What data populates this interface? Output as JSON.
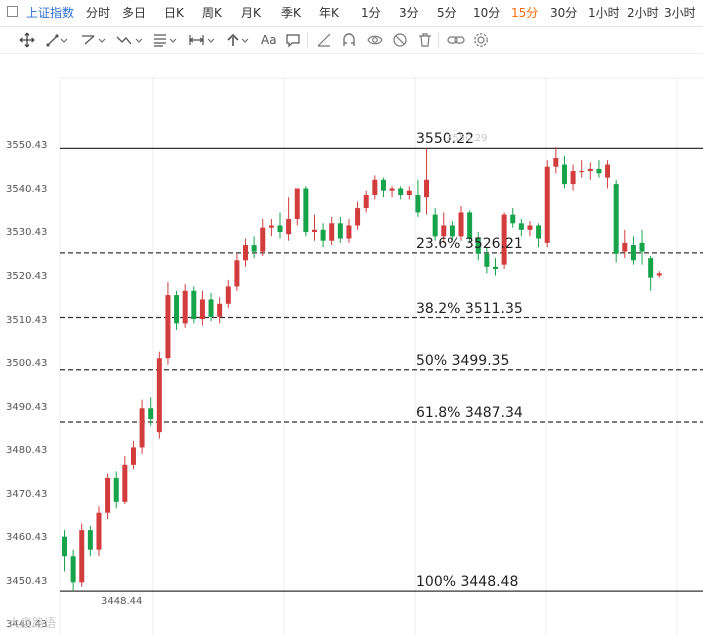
{
  "tabbar": {
    "tabs": [
      {
        "label": "上证指数",
        "type": "index"
      },
      {
        "label": "分时"
      },
      {
        "label": "多日"
      },
      {
        "label": "日K"
      },
      {
        "label": "周K"
      },
      {
        "label": "月K"
      },
      {
        "label": "季K"
      },
      {
        "label": "年K"
      },
      {
        "label": "1分"
      },
      {
        "label": "3分"
      },
      {
        "label": "5分"
      },
      {
        "label": "10分"
      },
      {
        "label": "15分",
        "active": true
      },
      {
        "label": "30分"
      },
      {
        "label": "1小时"
      },
      {
        "label": "2小时"
      },
      {
        "label": "3小时"
      }
    ]
  },
  "toolbar": {
    "icons": [
      "move-icon",
      "line-tool-icon",
      "parallel-channel-icon",
      "wave-tool-icon",
      "fibonacci-icon",
      "measure-icon",
      "arrow-up-icon",
      "text-tool-icon",
      "comment-icon",
      "ruler-icon",
      "magnet-icon",
      "visibility-icon",
      "hide-icon",
      "delete-icon",
      "link-icon",
      "settings-icon"
    ],
    "text_tool_label": "Aa"
  },
  "colors": {
    "up": "#d23c3c",
    "down": "#16a34a",
    "fib_line": "#333333",
    "grid": "#eeeeee",
    "active_tab": "#ff6a00"
  },
  "chart_data": {
    "type": "candlestick",
    "y_ticks": [
      "3550.43",
      "3540.43",
      "3530.43",
      "3520.43",
      "3510.43",
      "3500.43",
      "3490.43",
      "3480.43",
      "3470.43",
      "3460.43",
      "3450.43",
      "3440.43"
    ],
    "ylim": [
      3438.4,
      3571.9
    ],
    "low_marker": "3448.44",
    "high_ghost_label": "3550.29",
    "fib_levels": [
      {
        "label": "3550.22",
        "price": 3550.22,
        "style": "solid"
      },
      {
        "label": "23.6% 3526.21",
        "price": 3526.21,
        "style": "dashed"
      },
      {
        "label": "38.2% 3511.35",
        "price": 3511.35,
        "style": "dashed"
      },
      {
        "label": "50% 3499.35",
        "price": 3499.35,
        "style": "dashed"
      },
      {
        "label": "61.8% 3487.34",
        "price": 3487.34,
        "style": "dashed"
      },
      {
        "label": "100% 3448.48",
        "price": 3448.48,
        "style": "solid"
      }
    ],
    "candles": [
      [
        3461.0,
        3456.5,
        3462.5,
        3453.0
      ],
      [
        3456.5,
        3450.5,
        3458.0,
        3448.44
      ],
      [
        3450.5,
        3462.5,
        3464.0,
        3449.5
      ],
      [
        3462.5,
        3458.0,
        3463.5,
        3456.5
      ],
      [
        3458.0,
        3466.5,
        3468.0,
        3456.5
      ],
      [
        3466.5,
        3474.5,
        3475.5,
        3465.0
      ],
      [
        3474.5,
        3469.0,
        3476.0,
        3467.5
      ],
      [
        3469.0,
        3477.5,
        3479.5,
        3468.5
      ],
      [
        3477.5,
        3481.5,
        3483.0,
        3476.5
      ],
      [
        3481.5,
        3490.5,
        3492.5,
        3480.0
      ],
      [
        3490.5,
        3488.0,
        3493.0,
        3486.5
      ],
      [
        3485.0,
        3502.0,
        3503.5,
        3483.5
      ],
      [
        3502.0,
        3516.5,
        3519.5,
        3500.5
      ],
      [
        3516.5,
        3510.0,
        3517.5,
        3508.5
      ],
      [
        3510.0,
        3517.5,
        3519.0,
        3509.0
      ],
      [
        3517.5,
        3511.0,
        3518.5,
        3510.0
      ],
      [
        3511.0,
        3515.5,
        3517.5,
        3509.5
      ],
      [
        3515.5,
        3511.5,
        3517.0,
        3510.5
      ],
      [
        3511.5,
        3514.5,
        3516.0,
        3510.0
      ],
      [
        3514.5,
        3518.5,
        3520.0,
        3513.5
      ],
      [
        3518.5,
        3524.5,
        3526.0,
        3517.5
      ],
      [
        3524.5,
        3528.0,
        3529.5,
        3523.0
      ],
      [
        3528.0,
        3526.5,
        3530.0,
        3525.0
      ],
      [
        3526.5,
        3532.0,
        3534.0,
        3525.5
      ],
      [
        3532.0,
        3532.5,
        3534.0,
        3530.0
      ],
      [
        3532.5,
        3531.0,
        3535.5,
        3529.5
      ],
      [
        3530.5,
        3534.0,
        3539.0,
        3529.0
      ],
      [
        3534.0,
        3541.0,
        3541.0,
        3532.5
      ],
      [
        3541.0,
        3531.0,
        3541.5,
        3530.0
      ],
      [
        3531.0,
        3531.5,
        3535.0,
        3529.0
      ],
      [
        3531.5,
        3529.0,
        3533.0,
        3527.5
      ],
      [
        3529.0,
        3533.0,
        3534.5,
        3528.0
      ],
      [
        3533.0,
        3529.5,
        3534.5,
        3528.5
      ],
      [
        3529.5,
        3532.5,
        3534.0,
        3528.5
      ],
      [
        3532.5,
        3536.5,
        3538.0,
        3531.5
      ],
      [
        3536.5,
        3539.5,
        3540.5,
        3535.5
      ],
      [
        3539.5,
        3543.0,
        3544.0,
        3538.5
      ],
      [
        3543.0,
        3540.5,
        3543.5,
        3539.0
      ],
      [
        3540.5,
        3541.0,
        3541.5,
        3539.0
      ],
      [
        3541.0,
        3539.5,
        3541.5,
        3538.5
      ],
      [
        3539.5,
        3540.5,
        3541.5,
        3538.5
      ],
      [
        3539.5,
        3535.5,
        3543.0,
        3534.5
      ],
      [
        3539.0,
        3543.0,
        3550.22,
        3535.0
      ],
      [
        3535.0,
        3530.0,
        3536.5,
        3529.0
      ],
      [
        3530.0,
        3532.5,
        3535.5,
        3528.5
      ],
      [
        3532.5,
        3530.0,
        3533.5,
        3529.0
      ],
      [
        3530.0,
        3535.5,
        3537.0,
        3529.0
      ],
      [
        3535.5,
        3529.5,
        3536.0,
        3528.5
      ],
      [
        3529.5,
        3526.0,
        3531.0,
        3524.5
      ],
      [
        3526.0,
        3523.0,
        3527.5,
        3521.5
      ],
      [
        3523.0,
        3522.5,
        3525.0,
        3521.0
      ],
      [
        3523.5,
        3535.0,
        3535.5,
        3522.5
      ],
      [
        3535.0,
        3533.0,
        3536.5,
        3532.0
      ],
      [
        3533.0,
        3531.5,
        3534.0,
        3530.0
      ],
      [
        3531.5,
        3532.5,
        3533.5,
        3530.0
      ],
      [
        3532.5,
        3529.5,
        3533.0,
        3527.5
      ],
      [
        3528.5,
        3546.0,
        3547.5,
        3527.5
      ],
      [
        3546.0,
        3548.0,
        3550.5,
        3544.5
      ],
      [
        3546.5,
        3542.0,
        3548.5,
        3541.0
      ],
      [
        3542.0,
        3545.0,
        3546.5,
        3540.5
      ],
      [
        3545.0,
        3545.0,
        3547.5,
        3543.5
      ],
      [
        3545.0,
        3545.5,
        3547.0,
        3543.0
      ],
      [
        3545.5,
        3544.5,
        3547.5,
        3543.5
      ],
      [
        3543.5,
        3546.5,
        3547.5,
        3541.0
      ],
      [
        3542.0,
        3526.0,
        3543.0,
        3524.0
      ],
      [
        3526.5,
        3528.5,
        3531.5,
        3525.0
      ],
      [
        3528.0,
        3524.5,
        3530.0,
        3523.5
      ],
      [
        3528.5,
        3526.5,
        3531.5,
        3523.5
      ],
      [
        3525.0,
        3520.5,
        3525.5,
        3517.5
      ],
      [
        3521.0,
        3521.5,
        3522.0,
        3520.5
      ]
    ]
  },
  "watermark": "大盘路语"
}
